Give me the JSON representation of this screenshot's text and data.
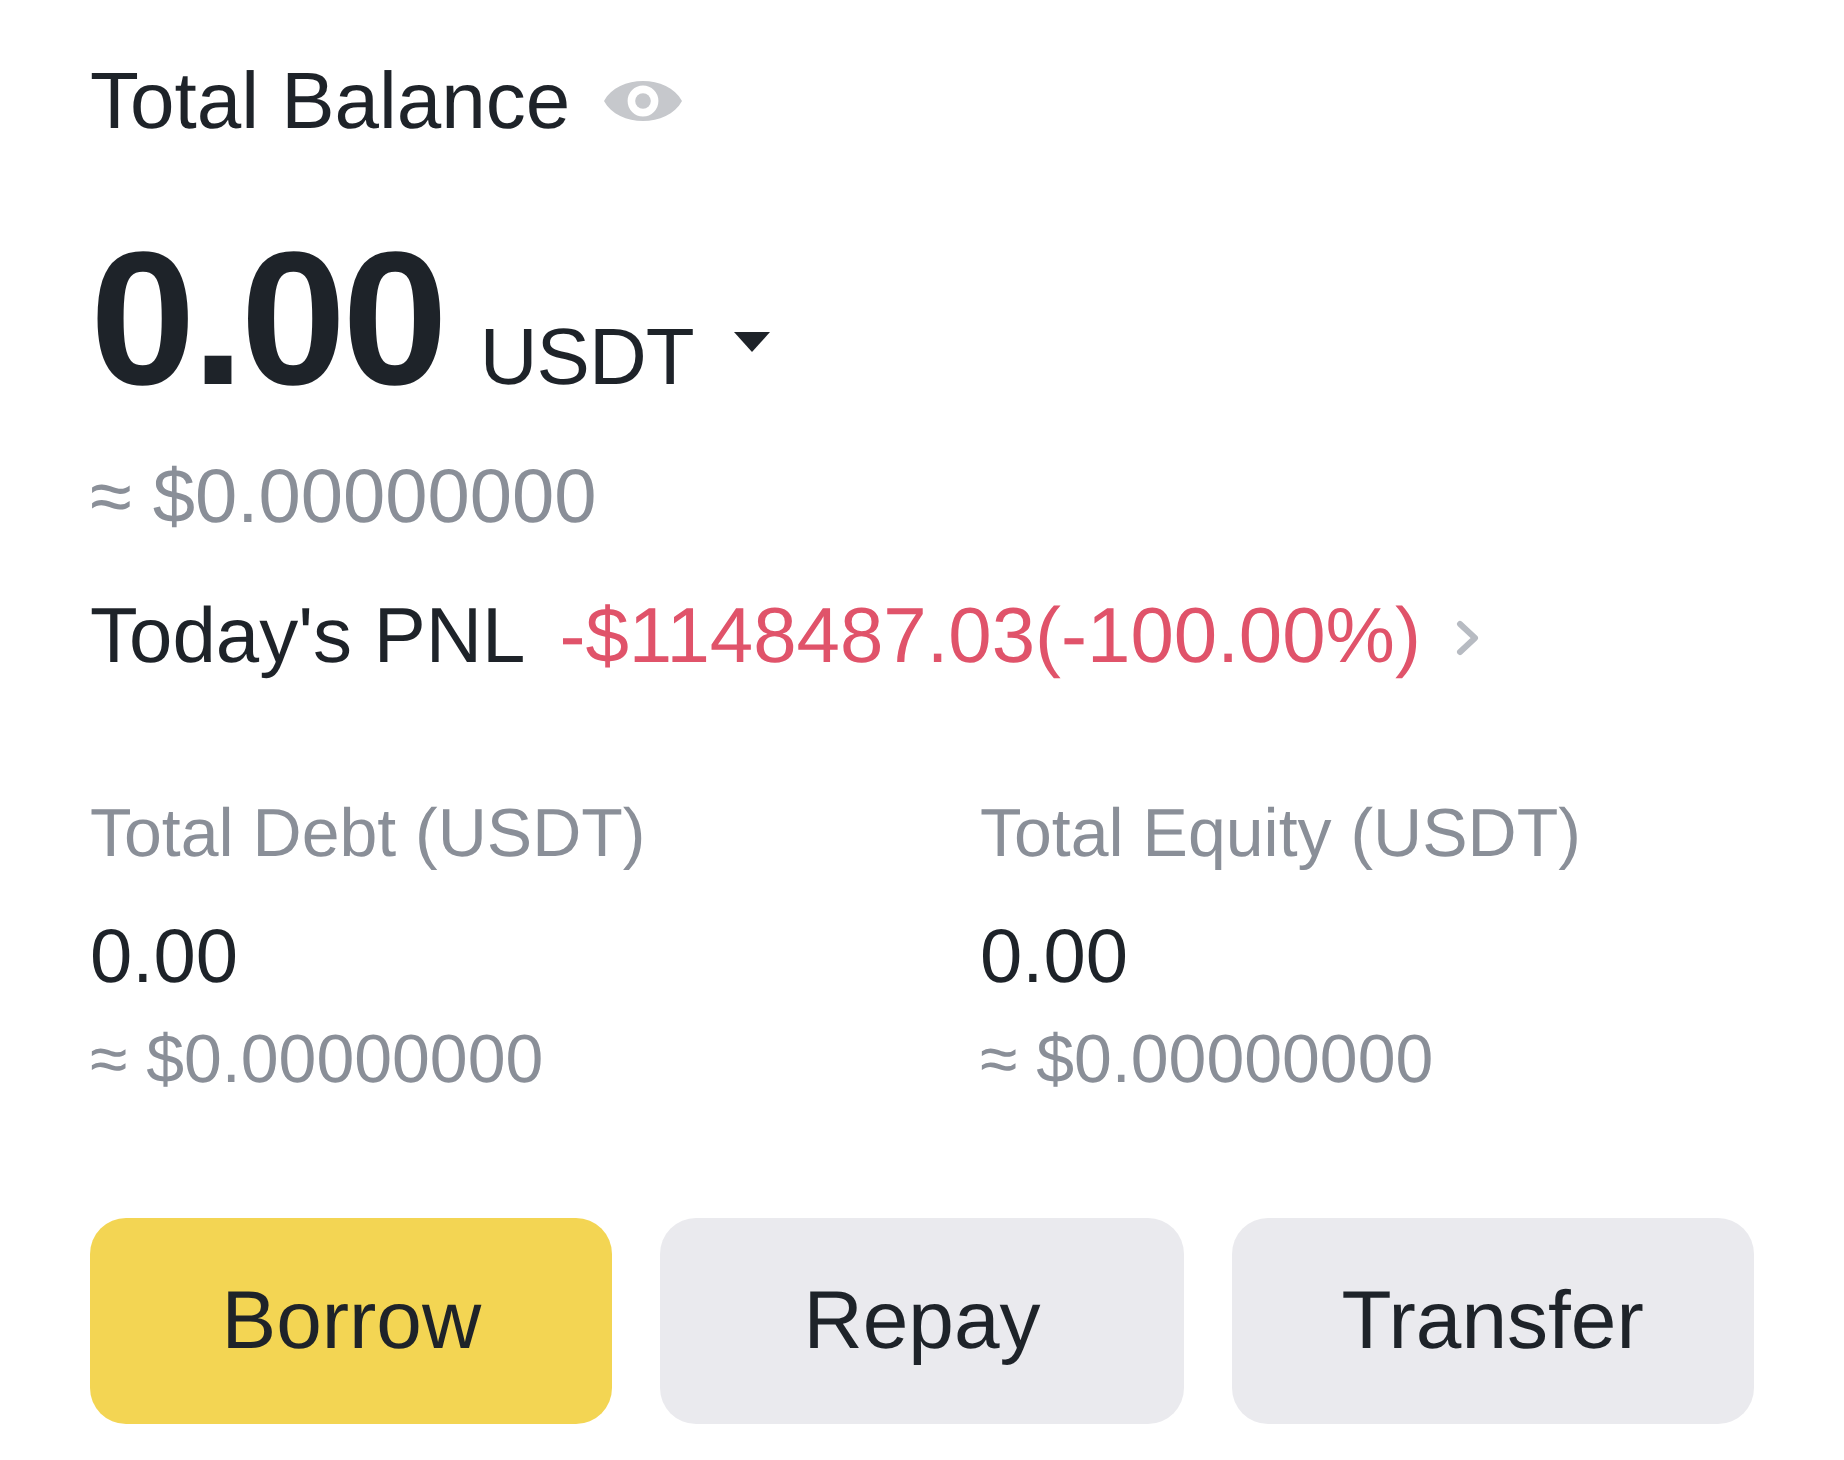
{
  "header": {
    "title": "Total Balance"
  },
  "balance": {
    "amount": "0.00",
    "currency": "USDT",
    "approx": "≈ $0.00000000"
  },
  "pnl": {
    "label": "Today's PNL",
    "value": "-$1148487.03(-100.00%)",
    "negative": true
  },
  "stats": [
    {
      "label": "Total Debt (USDT)",
      "value": "0.00",
      "approx": "≈ $0.00000000"
    },
    {
      "label": "Total Equity (USDT)",
      "value": "0.00",
      "approx": "≈ $0.00000000"
    }
  ],
  "buttons": [
    {
      "label": "Borrow",
      "kind": "primary"
    },
    {
      "label": "Repay",
      "kind": "secondary"
    },
    {
      "label": "Transfer",
      "kind": "secondary"
    }
  ]
}
